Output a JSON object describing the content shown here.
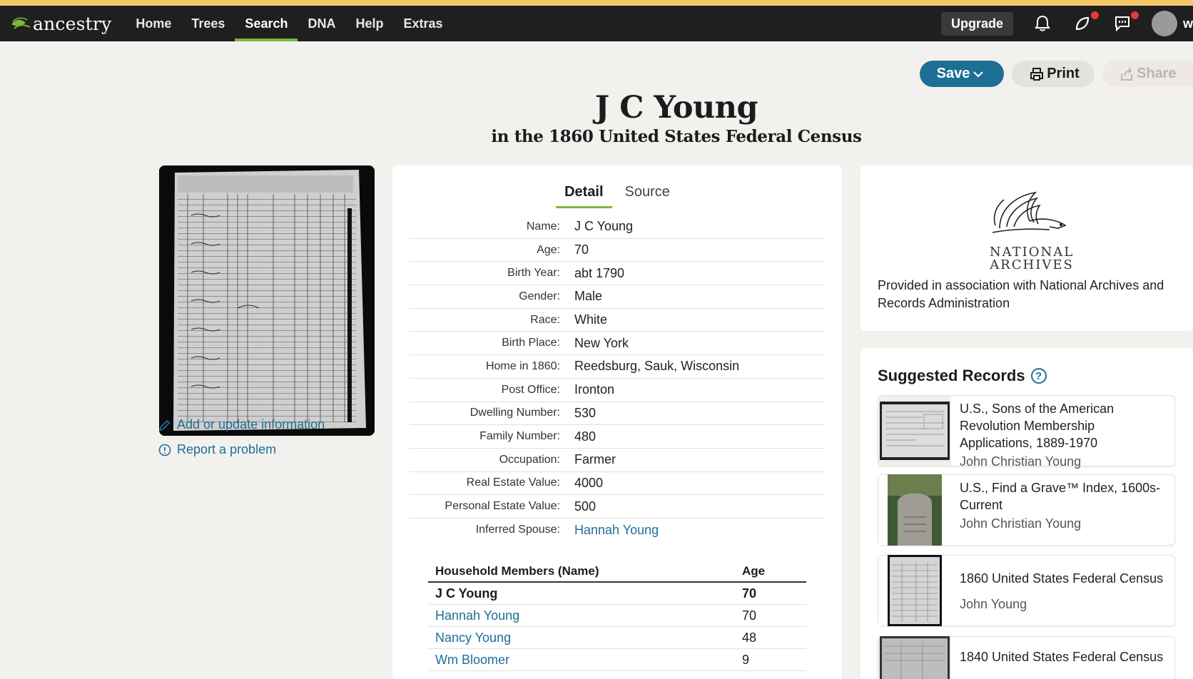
{
  "nav": {
    "logo_text": "ancestry",
    "links": [
      "Home",
      "Trees",
      "Search",
      "DNA",
      "Help",
      "Extras"
    ],
    "active": "Search",
    "upgrade_label": "Upgrade",
    "user_initial": "w"
  },
  "actions": {
    "save_label": "Save",
    "print_label": "Print",
    "share_label": "Share"
  },
  "record": {
    "title": "J C Young",
    "subtitle": "in the 1860 United States Federal Census"
  },
  "side_links": {
    "add_update": "Add or update information",
    "report": "Report a problem"
  },
  "tabs": [
    "Detail",
    "Source"
  ],
  "details": [
    {
      "label": "Name:",
      "value": "J C Young"
    },
    {
      "label": "Age:",
      "value": "70"
    },
    {
      "label": "Birth Year:",
      "value": "abt 1790"
    },
    {
      "label": "Gender:",
      "value": "Male"
    },
    {
      "label": "Race:",
      "value": "White"
    },
    {
      "label": "Birth Place:",
      "value": "New York"
    },
    {
      "label": "Home in 1860:",
      "value": "Reedsburg, Sauk, Wisconsin"
    },
    {
      "label": "Post Office:",
      "value": "Ironton"
    },
    {
      "label": "Dwelling Number:",
      "value": "530"
    },
    {
      "label": "Family Number:",
      "value": "480"
    },
    {
      "label": "Occupation:",
      "value": "Farmer"
    },
    {
      "label": "Real Estate Value:",
      "value": "4000"
    },
    {
      "label": "Personal Estate Value:",
      "value": "500"
    },
    {
      "label": "Inferred Spouse:",
      "value": "Hannah Young"
    }
  ],
  "household": {
    "col_name": "Household Members (Name)",
    "col_age": "Age",
    "rows": [
      {
        "name": "J C Young",
        "age": "70"
      },
      {
        "name": "Hannah Young",
        "age": "70"
      },
      {
        "name": "Nancy Young",
        "age": "48"
      },
      {
        "name": "Wm Bloomer",
        "age": "9"
      }
    ]
  },
  "archives": {
    "logo_line1": "NATIONAL",
    "logo_line2": "ARCHIVES",
    "text": "Provided in association with National Archives and Records Administration"
  },
  "suggested": {
    "title": "Suggested Records",
    "help": "?",
    "items": [
      {
        "name": "U.S., Sons of the American Revolution Membership Applications, 1889-1970",
        "person": "John Christian Young"
      },
      {
        "name": "U.S., Find a Grave™ Index, 1600s-Current",
        "person": "John Christian Young"
      },
      {
        "name": "1860 United States Federal Census",
        "person": "John Young"
      },
      {
        "name": "1840 United States Federal Census",
        "person": ""
      }
    ]
  },
  "colors": {
    "nav_bg": "#1f1f1f",
    "accent_green": "#7cb83a",
    "link_blue": "#1d6f95",
    "page_bg": "#f3f1ee"
  }
}
